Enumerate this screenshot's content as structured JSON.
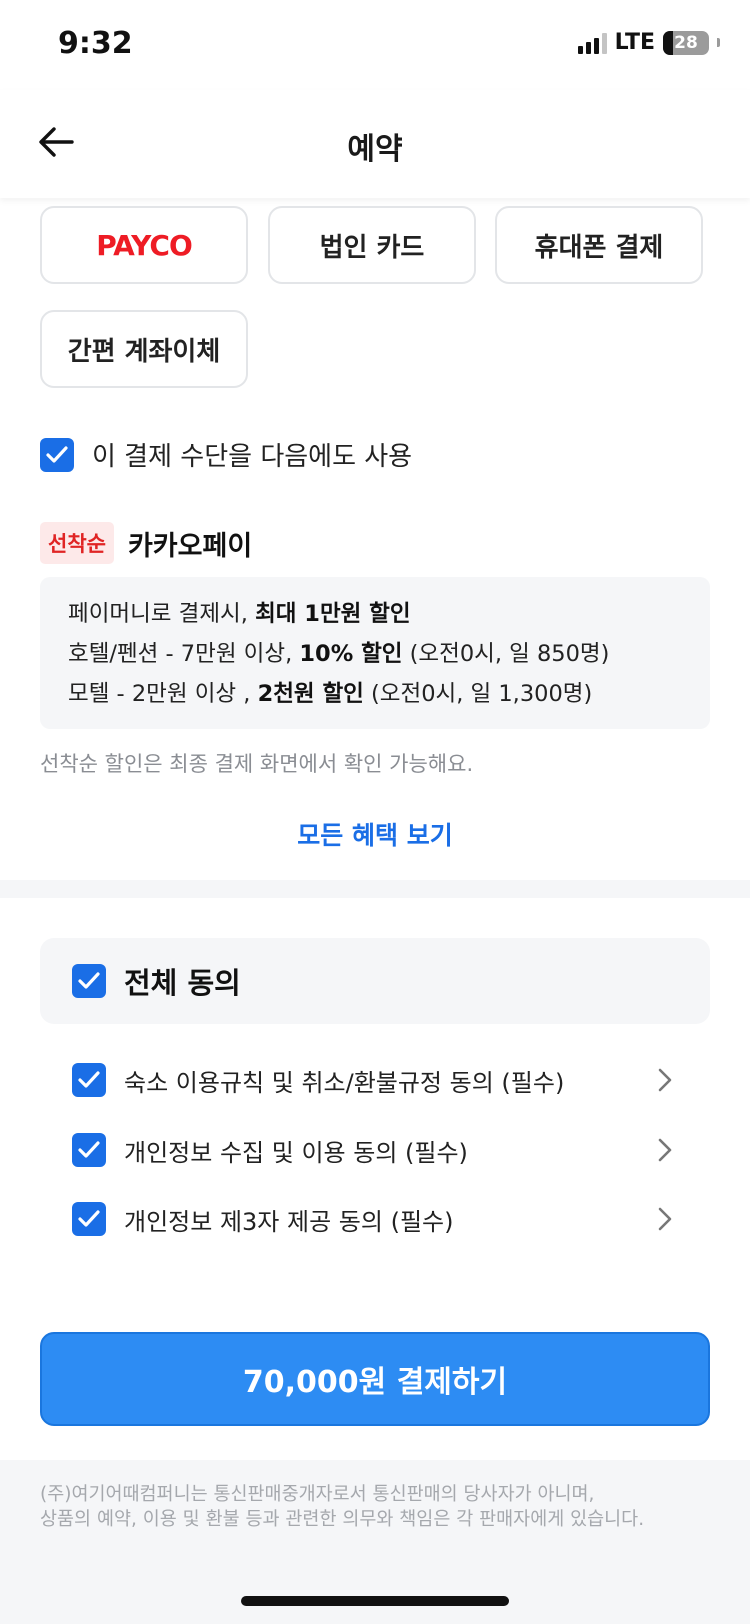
{
  "status": {
    "time": "9:32",
    "network": "LTE",
    "battery": "28"
  },
  "header": {
    "title": "예약"
  },
  "payment_methods": [
    "PAYCO",
    "법인 카드",
    "휴대폰 결제",
    "간편 계좌이체"
  ],
  "reuse": {
    "label": "이 결제 수단을 다음에도 사용",
    "checked": true
  },
  "promo": {
    "badge": "선착순",
    "name": "카카오페이",
    "line1_pre": "페이머니로 결제시, ",
    "line1_bold": "최대 1만원 할인",
    "line2_pre": "호텔/펜션 - 7만원 이상, ",
    "line2_bold": "10% 할인",
    "line2_post": " (오전0시, 일 850명)",
    "line3_pre": "모텔 - 2만원 이상 ,  ",
    "line3_bold": "2천원 할인",
    "line3_post": " (오전0시, 일 1,300명)",
    "note": "선착순 할인은 최종 결제 화면에서 확인 가능해요.",
    "all_benefits": "모든 혜택 보기"
  },
  "agreement": {
    "all_label": "전체 동의",
    "items": [
      "숙소 이용규칙 및 취소/환불규정 동의 (필수)",
      "개인정보 수집 및 이용 동의 (필수)",
      "개인정보 제3자 제공 동의 (필수)"
    ]
  },
  "pay_button": "70,000원 결제하기",
  "footer": {
    "line1": "(주)여기어때컴퍼니는 통신판매중개자로서 통신판매의 당사자가 아니며,",
    "line2": "상품의 예약, 이용 및 환불 등과 관련한 의무와 책임은 각 판매자에게 있습니다."
  },
  "colors": {
    "accent": "#2d8cf3",
    "checkbox": "#1a6ee6",
    "payco": "#ee1c25",
    "badge_text": "#e02424"
  }
}
